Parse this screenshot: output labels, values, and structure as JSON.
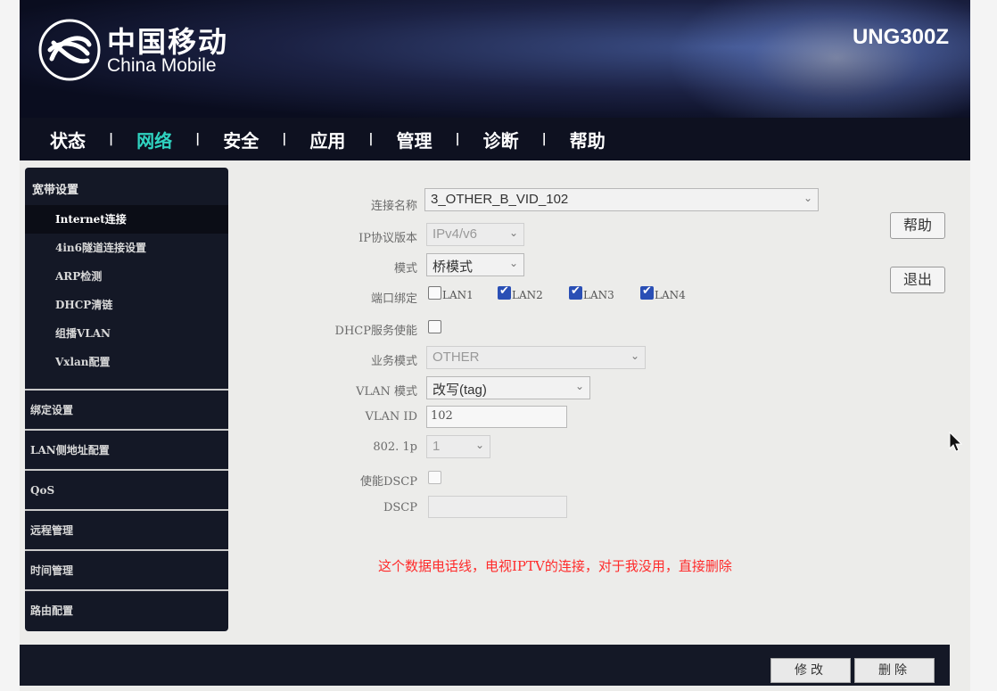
{
  "header": {
    "brand_cn": "中国移动",
    "brand_en": "China Mobile",
    "model": "UNG300Z"
  },
  "nav": {
    "items": [
      "状态",
      "网络",
      "安全",
      "应用",
      "管理",
      "诊断",
      "帮助"
    ],
    "separator": "|",
    "active": "网络"
  },
  "sidebar": {
    "section": "宽带设置",
    "sub_items": [
      "Internet连接",
      "4in6隧道连接设置",
      "ARP检测",
      "DHCP清链",
      "组播VLAN",
      "Vxlan配置"
    ],
    "active_sub": "Internet连接",
    "groups": [
      "绑定设置",
      "LAN侧地址配置",
      "QoS",
      "远程管理",
      "时间管理",
      "路由配置"
    ]
  },
  "form": {
    "connection_name_label": "连接名称",
    "connection_name_value": "3_OTHER_B_VID_102",
    "ip_version_label": "IP协议版本",
    "ip_version_value": "IPv4/v6",
    "mode_label": "模式",
    "mode_value": "桥模式",
    "port_binding_label": "端口绑定",
    "ports": [
      {
        "label": "LAN1",
        "checked": false
      },
      {
        "label": "LAN2",
        "checked": true
      },
      {
        "label": "LAN3",
        "checked": true
      },
      {
        "label": "LAN4",
        "checked": true
      }
    ],
    "dhcp_label": "DHCP服务使能",
    "service_mode_label": "业务模式",
    "service_mode_value": "OTHER",
    "vlan_mode_label": "VLAN 模式",
    "vlan_mode_value": "改写(tag)",
    "vlan_id_label": "VLAN ID",
    "vlan_id_value": "102",
    "p8021_label": "802. 1p",
    "p8021_value": "1",
    "dscp_enable_label": "使能DSCP",
    "dscp_label": "DSCP",
    "dscp_value": ""
  },
  "side_buttons": {
    "help": "帮助",
    "exit": "退出"
  },
  "note": "这个数据电话线，电视IPTV的连接，对于我没用，直接删除",
  "footer": {
    "modify": "修改",
    "delete": "删除"
  }
}
